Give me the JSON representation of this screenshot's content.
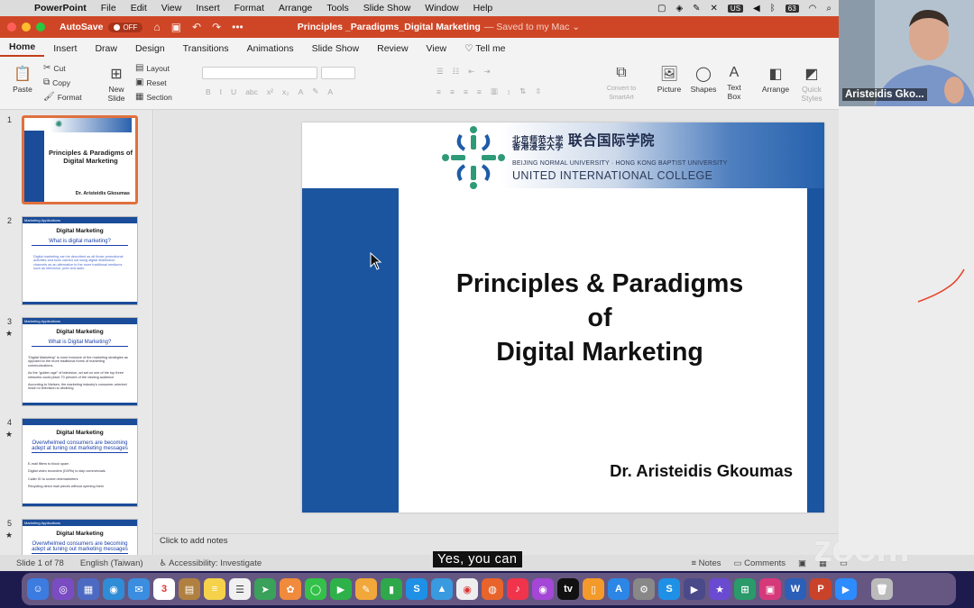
{
  "menubar": {
    "app": "PowerPoint",
    "items": [
      "File",
      "Edit",
      "View",
      "Insert",
      "Format",
      "Arrange",
      "Tools",
      "Slide Show",
      "Window",
      "Help"
    ],
    "input_badge": "US",
    "battery": "63"
  },
  "titlebar": {
    "autosave": "AutoSave",
    "toggle": "OFF",
    "title": "Principles _Paradigms_Digital Marketing",
    "saved": "— Saved to my Mac ⌄"
  },
  "ribbon_tabs": [
    "Home",
    "Insert",
    "Draw",
    "Design",
    "Transitions",
    "Animations",
    "Slide Show",
    "Review",
    "View",
    "Tell me"
  ],
  "ribbon": {
    "paste": "Paste",
    "cut": "Cut",
    "copy": "Copy",
    "format": "Format",
    "new_slide": "New Slide",
    "layout": "Layout",
    "reset": "Reset",
    "section": "Section",
    "convert": "Convert to SmartArt",
    "picture": "Picture",
    "shapes": "Shapes",
    "textbox": "Text Box",
    "arrange": "Arrange",
    "quick_styles": "Quick Styles"
  },
  "thumbnails": [
    {
      "num": "1",
      "title": "Principles & Paradigms of Digital Marketing",
      "author": "Dr. Aristeidis Gkoumas"
    },
    {
      "num": "2",
      "bar": "Marketing Applications",
      "head": "Digital Marketing",
      "sub": "What is digital marketing?",
      "lines": [
        "Digital marketing can be described as all those promotional activities and tools carried out using digital distribution channels as an alternative to the more traditional mediums such as television, print and radio"
      ]
    },
    {
      "num": "3",
      "bar": "Marketing Applications",
      "head": "Digital Marketing",
      "sub": "What is Digital Marketing?",
      "lines": [
        "“Digital Marketing” is more inclusive of the marketing strategies as opposed to the more traditional forms of marketing communications",
        "As the “golden age” of television, ad sat on one of the top three networks could place 70 percent of the viewing audience",
        "According to Nielsen, the marketing industry’s consumer-oriented reach to television is declining"
      ]
    },
    {
      "num": "4",
      "bar": "",
      "head": "Digital Marketing",
      "sub": "Overwhelmed consumers are becoming adept at tuning out marketing messages",
      "lines": [
        "E-mail filters to block spam",
        "Digital video recorders (DVRs) to skip commercials",
        "Caller ID to screen telemarketers",
        "Recycling direct mail pieces without opening them"
      ]
    },
    {
      "num": "5",
      "bar": "Marketing Applications",
      "head": "Digital Marketing",
      "sub": "Overwhelmed consumers are becoming adept at tuning out marketing messages",
      "lines": []
    }
  ],
  "slide": {
    "cn": "北京师范大学 联合国际学院",
    "cn_top": "北京师范大学",
    "cn_bottom": "香港浸会大学",
    "cn_big": "联合国际学院",
    "en_small": "BEIJING NORMAL UNIVERSITY · HONG KONG BAPTIST UNIVERSITY",
    "en_big": "UNITED INTERNATIONAL COLLEGE",
    "title_l1": "Principles & Paradigms",
    "title_l2": "of",
    "title_l3": "Digital Marketing",
    "author": "Dr. Aristeidis Gkoumas"
  },
  "notes": "Click to add notes",
  "status": {
    "slide": "Slide 1 of 78",
    "lang": "English (Taiwan)",
    "access": "Accessibility: Investigate",
    "notes": "Notes",
    "comments": "Comments",
    "zoom": "107%"
  },
  "caption": "Yes, you can",
  "video_name": "Aristeidis Gko...",
  "watermark": "zoom"
}
